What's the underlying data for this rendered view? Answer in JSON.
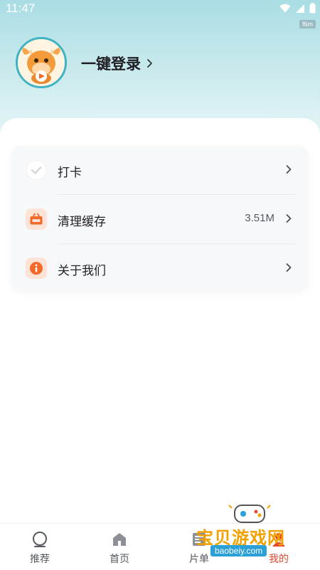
{
  "status_bar": {
    "time": "11:47",
    "badge": "f6m"
  },
  "profile": {
    "login_label": "一键登录",
    "avatar_icon": "cow-mascot-play-avatar"
  },
  "menu": {
    "items": [
      {
        "label": "打卡",
        "value": "",
        "icon": "check-circle-icon"
      },
      {
        "label": "清理缓存",
        "value": "3.51M",
        "icon": "basket-clean-icon"
      },
      {
        "label": "关于我们",
        "value": "",
        "icon": "info-icon"
      }
    ]
  },
  "tabbar": {
    "tabs": [
      {
        "label": "推荐",
        "icon": "circle-icon"
      },
      {
        "label": "首页",
        "icon": "home-icon"
      },
      {
        "label": "片单",
        "icon": "list-icon"
      },
      {
        "label": "我的",
        "icon": "user-icon"
      }
    ]
  },
  "watermark": {
    "title": "宝贝游戏网",
    "url": "baobeiy.com"
  },
  "colors": {
    "accent": "#3fb3c2",
    "header_top": "#a9dde4",
    "menu_icon_orange": "#f26a2a",
    "menu_icon_bg": "#fde3d6"
  }
}
